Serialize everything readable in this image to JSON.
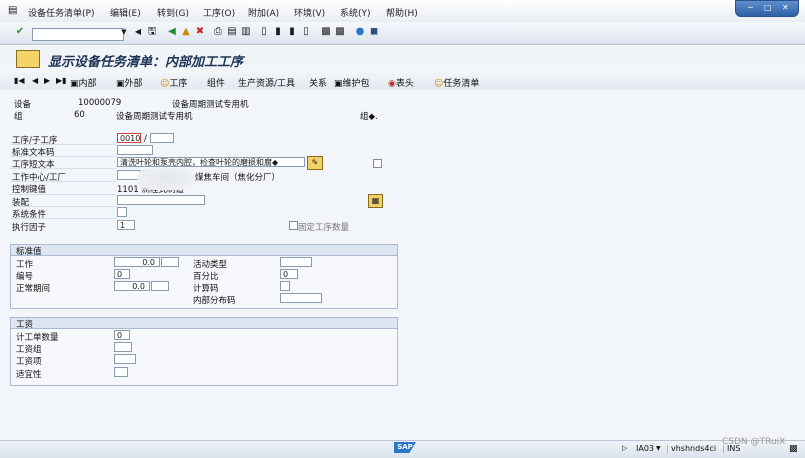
{
  "menubar": {
    "items": [
      "设备任务清单(P)",
      "编辑(E)",
      "转到(G)",
      "工序(O)",
      "附加(A)",
      "环境(V)",
      "系统(Y)",
      "帮助(H)"
    ]
  },
  "title": "显示设备任务清单：内部加工工序",
  "app_toolbar": {
    "internal": "内部",
    "external": "外部",
    "operation": "工序",
    "component": "组件",
    "prt": "生产资源/工具",
    "relation": "关系",
    "maint_pkg": "维护包",
    "header": "表头",
    "task_list": "任务清单"
  },
  "header": {
    "equipment_label": "设备",
    "equipment_value": "10000079",
    "equipment_desc": "设备周期测试专用机",
    "group_label": "组",
    "group_value": "60",
    "group_desc": "设备周期测试专用机",
    "group_counter": "组◆."
  },
  "form": {
    "op_label": "工序/子工序",
    "op_value": "0010",
    "op_sep": "/",
    "std_text_label": "标准文本码",
    "short_text_label": "工序短文本",
    "short_text_value": "清洗叶轮和泵壳内腔，检查叶轮的磨损和腐◆",
    "work_center_label": "工作中心/工厂",
    "work_center_desc": "煤焦车间（焦化分厂）",
    "control_key_label": "控制键值",
    "control_key_value": "1101 流程式制造",
    "assembly_label": "装配",
    "sys_cond_label": "系统条件",
    "exec_factor_label": "执行因子",
    "exec_factor_value": "1",
    "fixed_qty_label": "固定工序数量"
  },
  "std_values": {
    "title": "标准值",
    "work_label": "工作",
    "work_value": "0.0",
    "number_label": "编号",
    "number_value": "0",
    "normal_duration_label": "正常期间",
    "normal_duration_value": "0.0",
    "activity_type_label": "活动类型",
    "percent_label": "百分比",
    "percent_value": "0",
    "calc_key_label": "计算码",
    "int_dist_label": "内部分布码"
  },
  "wages": {
    "title": "工资",
    "piece_qty_label": "计工单数量",
    "piece_qty_value": "0",
    "wage_group_label": "工资组",
    "wage_type_label": "工资项",
    "suitability_label": "适宜性"
  },
  "statusbar": {
    "transaction": "IA03",
    "server": "vhshnds4ci",
    "mode": "INS",
    "watermark": "CSDN @TRuiX"
  },
  "colors": {
    "accent": "#2a77c8",
    "title_text": "#1d3355",
    "group_border": "#a9bbd3"
  }
}
